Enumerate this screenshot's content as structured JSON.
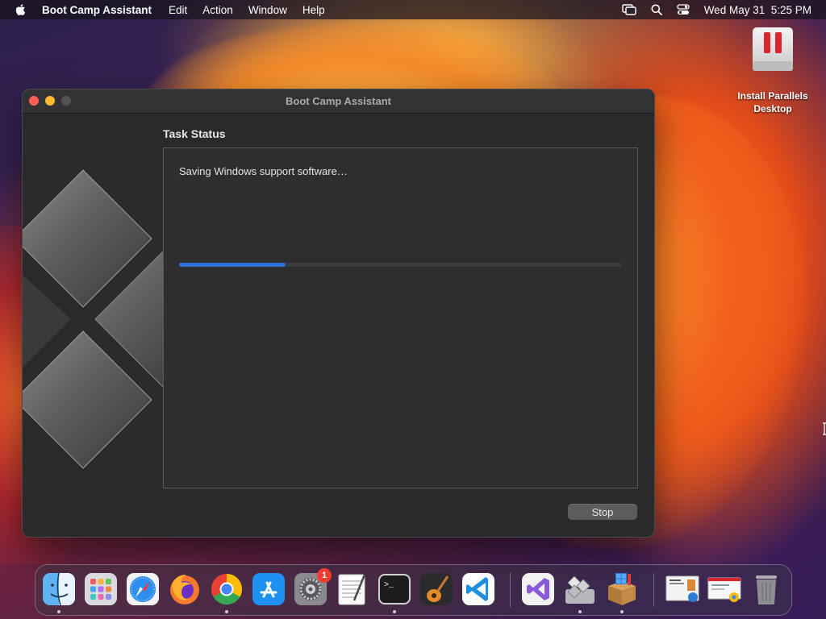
{
  "menubar": {
    "app_name": "Boot Camp Assistant",
    "menus": [
      "Edit",
      "Action",
      "Window",
      "Help"
    ],
    "clock": "Wed May 31  5:25 PM"
  },
  "desktop": {
    "icon_label_line1": "Install Parallels",
    "icon_label_line2": "Desktop"
  },
  "window": {
    "title": "Boot Camp Assistant",
    "section_heading": "Task Status",
    "status_text": "Saving Windows support software…",
    "progress_fraction": 0.24,
    "stop_label": "Stop"
  },
  "dock": {
    "settings_badge": "1",
    "items": [
      "finder-icon",
      "launchpad-icon",
      "safari-icon",
      "firefox-icon",
      "chrome-icon",
      "app-store-icon",
      "system-settings-icon",
      "textedit-icon",
      "terminal-icon",
      "garageband-icon",
      "vscode-icon",
      "visual-studio-icon",
      "boot-camp-icon",
      "installer-icon",
      "document-thumbnail-icon",
      "chrome-web-app-icon",
      "trash-icon"
    ]
  },
  "colors": {
    "accent_blue": "#2f6fd8",
    "close_red": "#ff5f57",
    "minimize_yellow": "#febc2e"
  }
}
